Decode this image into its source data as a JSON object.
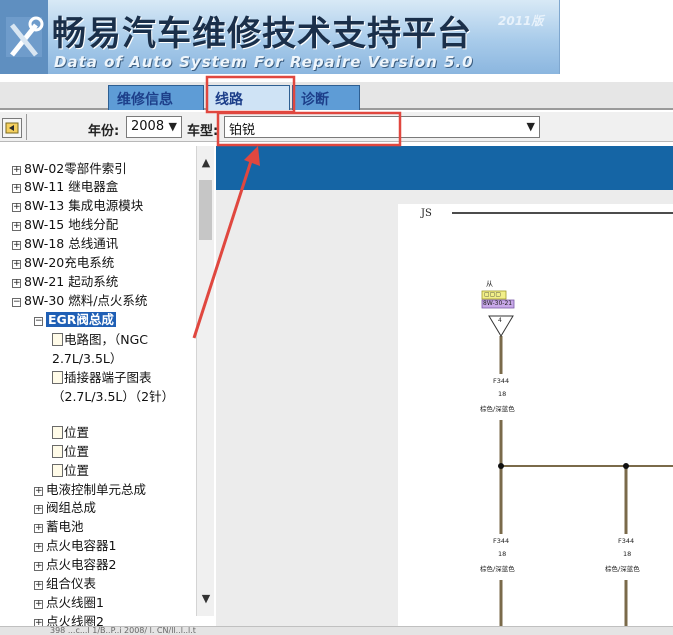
{
  "banner": {
    "title": "畅易汽车维修技术支持平台",
    "version": "2011版",
    "subtitle": "Data of Auto System For Repaire Version 5.0"
  },
  "tabs": [
    {
      "label": "维修信息",
      "active": false
    },
    {
      "label": "线路",
      "active": true
    },
    {
      "label": "诊断",
      "active": false
    }
  ],
  "filters": {
    "year_label": "年份:",
    "year_value": "2008",
    "model_label": "车型:",
    "model_value": "铂锐"
  },
  "tree": {
    "items": [
      "8W-02零部件索引",
      "8W-11 继电器盒",
      "8W-13 集成电源模块",
      "8W-15 地线分配",
      "8W-18 总线通讯",
      "8W-20充电系统",
      "8W-21 起动系统",
      "8W-30 燃料/点火系统"
    ],
    "selected": "EGR阀总成",
    "docs": [
      "电路图，（NGC 2.7L/3.5L）",
      "插接器端子图表（2.7L/3.5L）（2针）",
      "位置",
      "位置",
      "位置"
    ],
    "siblings": [
      "电液控制单元总成",
      "阀组总成",
      "蓄电池",
      "点火电容器1",
      "点火电容器2",
      "组合仪表",
      "点火线圈1",
      "点火线圈2"
    ]
  },
  "diagram": {
    "header": "JS",
    "source_label": "从",
    "tag_top": "▢▢▢",
    "tag_code": "8W-30-21",
    "pin": "4",
    "wires": [
      {
        "code": "F344",
        "gauge": "18",
        "color": "棕色/深蓝色"
      },
      {
        "code": "F344",
        "gauge": "18",
        "color": "棕色/深蓝色"
      },
      {
        "code": "F344",
        "gauge": "18",
        "color": "棕色/深蓝色"
      }
    ]
  },
  "status_text": "398 ...c...l 1/B..P..i 2008/ l. CN/ll..l..l.t",
  "colors": {
    "tab_blue": "#5e9cd6",
    "bar_blue": "#1565a5",
    "highlight_red": "#e0473f",
    "wire_brown": "#7a6a4a"
  }
}
